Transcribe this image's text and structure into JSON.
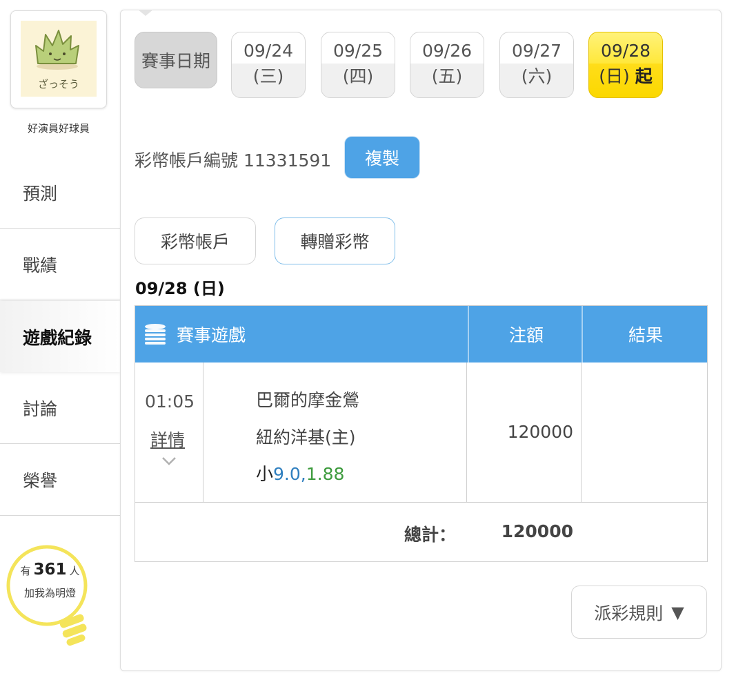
{
  "profile": {
    "username": "好演員好球員",
    "avatar_text": "ざっそう"
  },
  "nav": [
    {
      "label": "預測"
    },
    {
      "label": "戰績"
    },
    {
      "label": "遊戲紀錄",
      "active": true
    },
    {
      "label": "討論"
    },
    {
      "label": "榮譽"
    }
  ],
  "fans": {
    "prefix": "有",
    "count": "361",
    "suffix": "人",
    "caption": "加我為明燈"
  },
  "dates": {
    "label": "賽事日期",
    "items": [
      {
        "date": "09/24",
        "weekday": "(三)"
      },
      {
        "date": "09/25",
        "weekday": "(四)"
      },
      {
        "date": "09/26",
        "weekday": "(五)"
      },
      {
        "date": "09/27",
        "weekday": "(六)"
      },
      {
        "date": "09/28",
        "weekday": "(日)",
        "suffix": "起",
        "active": true
      }
    ]
  },
  "account": {
    "label": "彩幣帳戶編號 11331591",
    "copy_label": "複製"
  },
  "tabs": {
    "account": "彩幣帳戶",
    "transfer": "轉贈彩幣"
  },
  "day_heading": "09/28 (日)",
  "table": {
    "headers": {
      "game": "賽事遊戲",
      "stake": "注額",
      "result": "結果"
    },
    "rows": [
      {
        "time": "01:05",
        "detail_label": "詳情",
        "team_away": "巴爾的摩金鶯",
        "team_home": "紐約洋基(主)",
        "bet_side": "小",
        "bet_line": "9.0,",
        "bet_odds": "1.88",
        "stake": "120000",
        "result": ""
      }
    ],
    "total_label": "總計：",
    "total_value": "120000"
  },
  "rules_label": "派彩規則",
  "colors": {
    "accent_blue": "#4ea3e6",
    "active_yellow": "#ffe83a",
    "odds_green": "#3d9b3d",
    "line_blue": "#2f7fbf"
  }
}
